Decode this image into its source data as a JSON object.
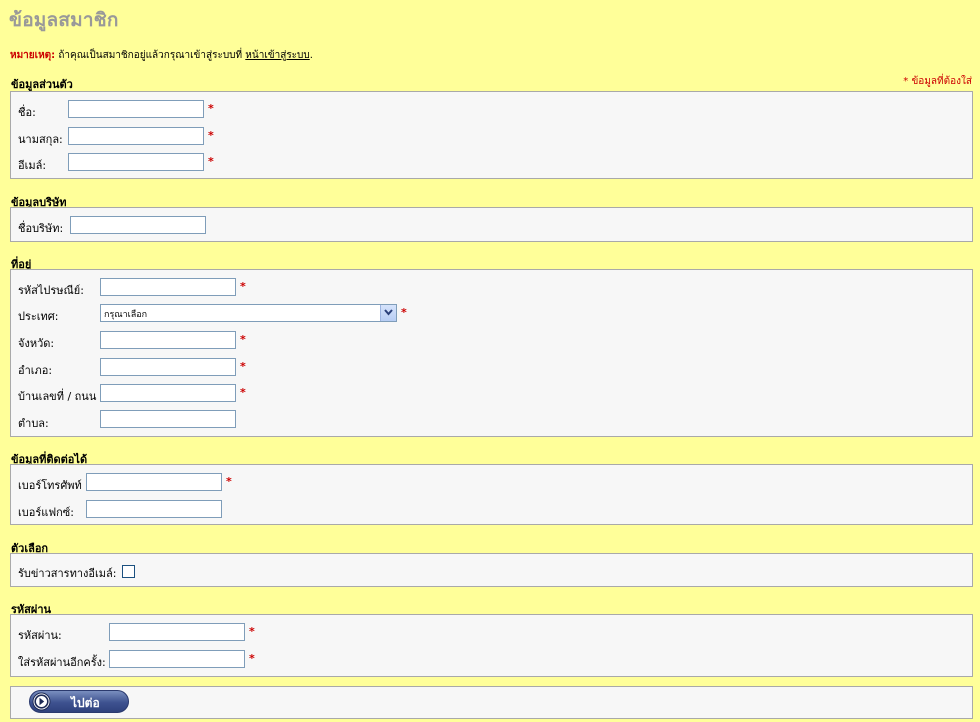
{
  "page": {
    "title": "ข้อมูลสมาชิก",
    "note_label": "หมายเหตุ:",
    "note_text": " ถ้าคุณเป็นสมาชิกอยู่แล้วกรุณาเข้าสู่ระบบที่ ",
    "note_link": "หน้าเข้าสู่ระบบ",
    "note_end": ".",
    "required_note": "* ข้อมูลที่ต้องใส่",
    "star": "*"
  },
  "personal": {
    "title": "ข้อมูลส่วนตัว",
    "first_name_label": "ชื่อ:",
    "last_name_label": "นามสกุล:",
    "email_label": "อีเมล์:"
  },
  "company": {
    "title": "ข้อมูลบริษัท",
    "company_name_label": "ชื่อบริษัท:"
  },
  "address": {
    "title": "ที่อยู่",
    "postcode_label": "รหัสไปรษณีย์:",
    "country_label": "ประเทศ:",
    "country_selected": "กรุณาเลือก",
    "province_label": "จังหวัด:",
    "district_label": "อำเภอ:",
    "street_label": "บ้านเลขที่ / ถนน",
    "subdistrict_label": "ตำบล:"
  },
  "contact": {
    "title": "ข้อมูลที่ติดต่อได้",
    "phone_label": "เบอร์โทรศัพท์",
    "fax_label": "เบอร์แฟกซ์:"
  },
  "options": {
    "title": "ตัวเลือก",
    "newsletter_label": "รับข่าวสารทางอีเมล์:"
  },
  "password": {
    "title": "รหัสผ่าน",
    "password_label": "รหัสผ่าน:",
    "confirm_label": "ใส่รหัสผ่านอีกครั้ง:"
  },
  "actions": {
    "continue_label": "ไปต่อ"
  },
  "colors": {
    "background": "#ffff99",
    "panel": "#f7f7f7",
    "required": "#cc0000",
    "button": "#3e5290"
  },
  "icons": {
    "continue": "arrow-right-circle-icon",
    "dropdown": "chevron-down-icon"
  }
}
